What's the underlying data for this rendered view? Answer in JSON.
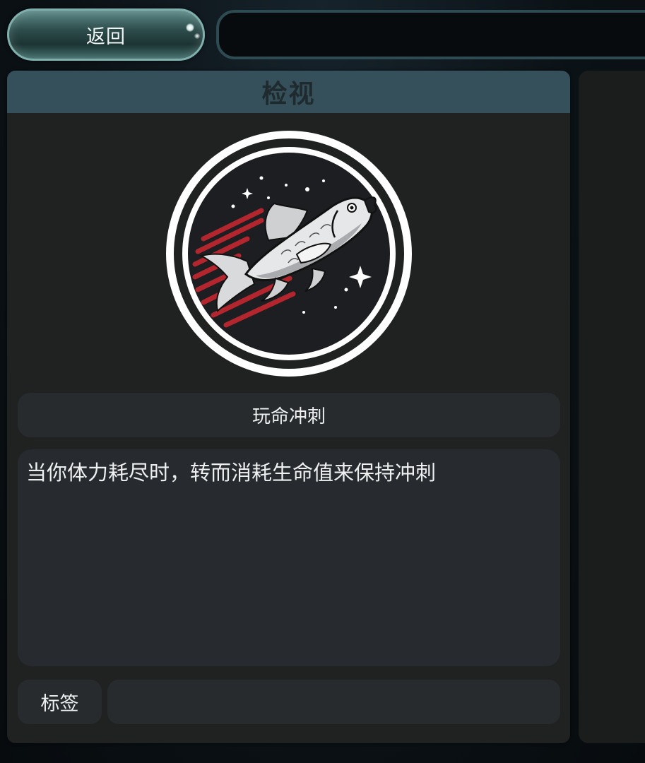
{
  "top_bar": {
    "back_label": "返回",
    "search_value": ""
  },
  "inspect_panel": {
    "title": "检视",
    "emblem_icon": "leaping-fish-icon",
    "skill_name": "玩命冲刺",
    "description": "当你体力耗尽时，转而消耗生命值来保持冲刺",
    "tag_label": "标签",
    "tag_value": ""
  },
  "colors": {
    "header": "#35505a",
    "panel": "#202121",
    "field": "#282b2e",
    "accent_red": "#b3262e",
    "button_border": "#7fb0ad"
  }
}
